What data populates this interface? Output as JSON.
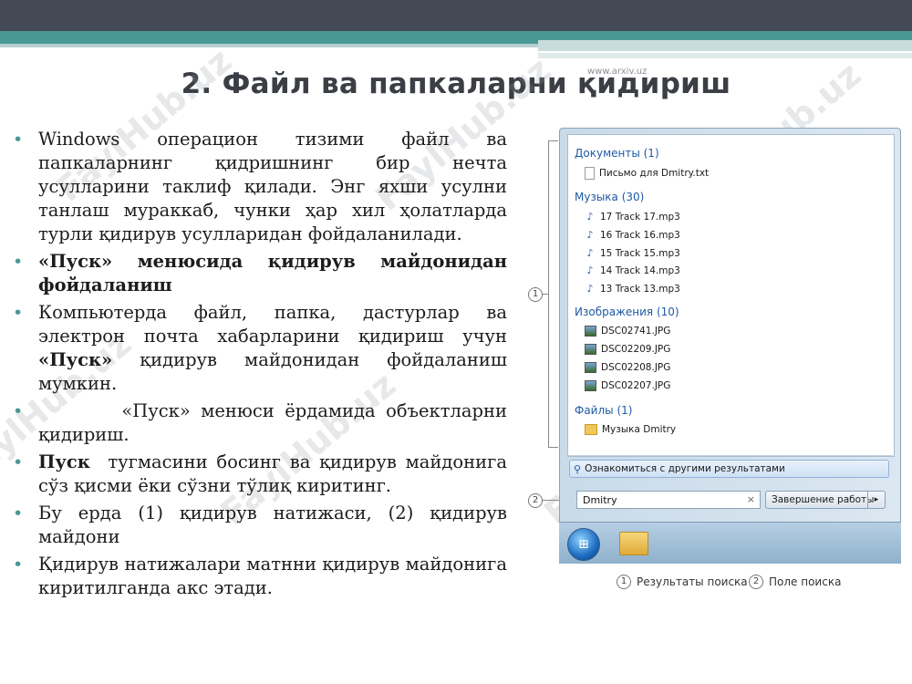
{
  "site_url": "www.arxiv.uz",
  "title": "2. Файл ва папкаларни қидириш",
  "watermark": "FaylHub.uz",
  "bullets": [
    {
      "pre": "Windows операцион тизими файл ва папкаларнинг қидришнинг бир нечта усулларини таклиф қилади. Энг яхши усулни танлаш мураккаб, чунки ҳар хил ҳолатларда турли қидирув усулларидан фойдаланилади.",
      "bold": "",
      "post": ""
    },
    {
      "pre": "",
      "bold": "«Пуск» менюсида қидирув майдонидан фойдаланиш",
      "post": ""
    },
    {
      "pre": "Компьютерда файл, папка, дастурлар ва электрон почта хабарларини қидириш учун ",
      "bold": "«Пуск»",
      "post": " қидирув майдонидан фойдаланиш мумкин."
    },
    {
      "pre": "        «Пуск» менюси ёрдамида объектларни қидириш.",
      "bold": "",
      "post": ""
    },
    {
      "pre": "",
      "bold": "Пуск",
      "post": "  тугмасини босинг ва қидирув майдонига сўз қисми ёки сўзни тўлиқ киритинг."
    },
    {
      "pre": "Бу ерда (1) қидирув натижаси, (2) қидирув майдони",
      "bold": "",
      "post": ""
    },
    {
      "pre": "Қидирув натижалари матнни қидирув майдонига киритилганда акс этади.",
      "bold": "",
      "post": ""
    }
  ],
  "start_menu": {
    "groups": [
      {
        "label": "Документы (1)",
        "icon": "document-icon",
        "items": [
          "Письмо для Dmitry.txt"
        ]
      },
      {
        "label": "Музыка (30)",
        "icon": "music-file-icon",
        "items": [
          "17 Track 17.mp3",
          "16 Track 16.mp3",
          "15 Track 15.mp3",
          "14 Track 14.mp3",
          "13 Track 13.mp3"
        ]
      },
      {
        "label": "Изображения (10)",
        "icon": "image-file-icon",
        "items": [
          "DSC02741.JPG",
          "DSC02209.JPG",
          "DSC02208.JPG",
          "DSC02207.JPG"
        ]
      },
      {
        "label": "Файлы (1)",
        "icon": "folder-icon",
        "items": [
          "Музыка Dmitry"
        ]
      }
    ],
    "more_results": "Ознакомиться с другими результатами",
    "search_value": "Dmitry",
    "clear_glyph": "×",
    "shutdown_label": "Завершение работы",
    "shutdown_arrow": "▸"
  },
  "callouts": {
    "one": "1",
    "two": "2"
  },
  "legend": {
    "one_label": "Результаты поиска",
    "two_label": "Поле поиска"
  },
  "colors": {
    "accent": "#4a9896",
    "dark_band": "#434955",
    "group_heading": "#1f5aa6"
  }
}
